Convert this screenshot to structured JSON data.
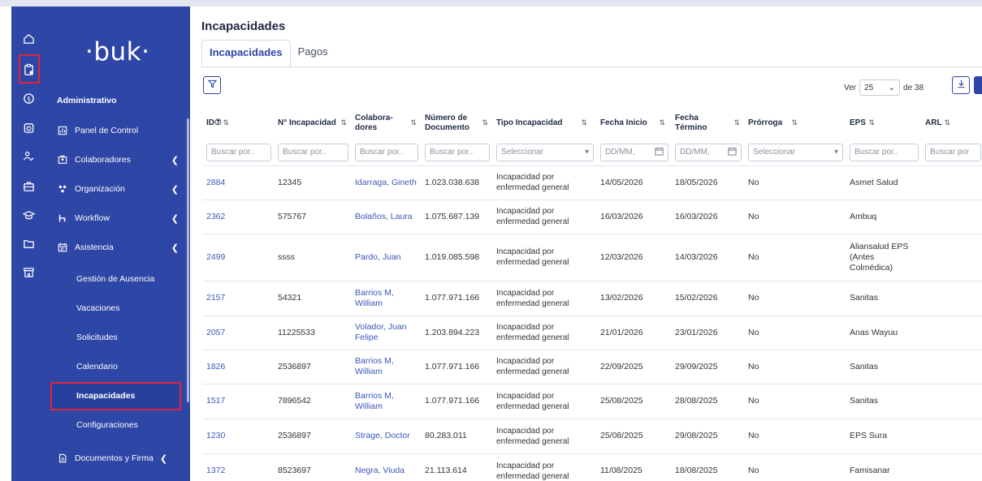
{
  "rail": {
    "icons": [
      "home-icon",
      "clipboard-icon",
      "dollar-icon",
      "camera-icon",
      "users-icon",
      "briefcase-icon",
      "graduation-cap-icon",
      "folder-icon",
      "store-icon"
    ]
  },
  "sidebar": {
    "logo": "·buk·",
    "section": "Administrativo",
    "items": [
      {
        "label": "Panel de Control",
        "icon": "dashboard-icon",
        "chevron": false
      },
      {
        "label": "Colaboradores",
        "icon": "people-icon",
        "chevron": true
      },
      {
        "label": "Organización",
        "icon": "org-icon",
        "chevron": true
      },
      {
        "label": "Workflow",
        "icon": "workflow-icon",
        "chevron": true
      },
      {
        "label": "Asistencia",
        "icon": "calendar-icon",
        "chevron": true
      }
    ],
    "subitems": [
      "Gestión de Ausencia",
      "Vacaciones",
      "Solicitudes",
      "Calendario",
      "Incapacidades",
      "Configuraciones"
    ],
    "bottom_item": {
      "label": "Documentos y Firma",
      "icon": "docs-icon"
    }
  },
  "main": {
    "title": "Incapacidades",
    "tabs": [
      "Incapacidades",
      "Pagos"
    ],
    "ver_label": "Ver",
    "page_size": "25",
    "of_label": "de 38",
    "columns": [
      "ID⑦",
      "N° Incapacidad",
      "Colabora- dores",
      "Número de Documento",
      "Tipo Incapacidad",
      "Fecha Inicio",
      "Fecha Término",
      "Prórroga",
      "EPS",
      "ARL"
    ],
    "filters": [
      "Buscar por..",
      "Buscar por..",
      "Buscar por..",
      "Buscar por..",
      "Seleccionar",
      "DD/MM,",
      "DD/MM,",
      "Seleccionar",
      "Buscar por..",
      "Buscar por"
    ],
    "rows": [
      {
        "id": "2884",
        "num": "12345",
        "colab": "Idarraga, Gineth",
        "doc": "1.023.038.638",
        "tipo": "Incapacidad por enfermedad general",
        "inicio": "14/05/2026",
        "fin": "18/05/2026",
        "prorroga": "No",
        "eps": "Asmet Salud"
      },
      {
        "id": "2362",
        "num": "575767",
        "colab": "Bolaños, Laura",
        "doc": "1.075.687.139",
        "tipo": "Incapacidad por enfermedad general",
        "inicio": "16/03/2026",
        "fin": "16/03/2026",
        "prorroga": "No",
        "eps": "Ambuq"
      },
      {
        "id": "2499",
        "num": "ssss",
        "colab": "Pardo, Juan",
        "doc": "1.019.085.598",
        "tipo": "Incapacidad por enfermedad general",
        "inicio": "12/03/2026",
        "fin": "14/03/2026",
        "prorroga": "No",
        "eps": "Aliansalud EPS (Antes Colmédica)"
      },
      {
        "id": "2157",
        "num": "54321",
        "colab": "Barrios M, William",
        "doc": "1.077.971.166",
        "tipo": "Incapacidad por enfermedad general",
        "inicio": "13/02/2026",
        "fin": "15/02/2026",
        "prorroga": "No",
        "eps": "Sanitas"
      },
      {
        "id": "2057",
        "num": "11225533",
        "colab": "Volador, Juan Felipe",
        "doc": "1.203.894.223",
        "tipo": "Incapacidad por enfermedad general",
        "inicio": "21/01/2026",
        "fin": "23/01/2026",
        "prorroga": "No",
        "eps": "Anas Wayuu"
      },
      {
        "id": "1826",
        "num": "2536897",
        "colab": "Barrios M, William",
        "doc": "1.077.971.166",
        "tipo": "Incapacidad por enfermedad general",
        "inicio": "22/09/2025",
        "fin": "29/09/2025",
        "prorroga": "No",
        "eps": "Sanitas"
      },
      {
        "id": "1517",
        "num": "7896542",
        "colab": "Barrios M, William",
        "doc": "1.077.971.166",
        "tipo": "Incapacidad por enfermedad general",
        "inicio": "25/08/2025",
        "fin": "28/08/2025",
        "prorroga": "No",
        "eps": "Sanitas"
      },
      {
        "id": "1230",
        "num": "2536897",
        "colab": "Strage, Doctor",
        "doc": "80.283.011",
        "tipo": "Incapacidad por enfermedad general",
        "inicio": "25/08/2025",
        "fin": "29/08/2025",
        "prorroga": "No",
        "eps": "EPS Sura"
      },
      {
        "id": "1372",
        "num": "8523697",
        "colab": "Negra, Viuda",
        "doc": "21.113.614",
        "tipo": "Incapacidad por enfermedad general",
        "inicio": "11/08/2025",
        "fin": "18/08/2025",
        "prorroga": "No",
        "eps": "Famisanar"
      }
    ]
  }
}
